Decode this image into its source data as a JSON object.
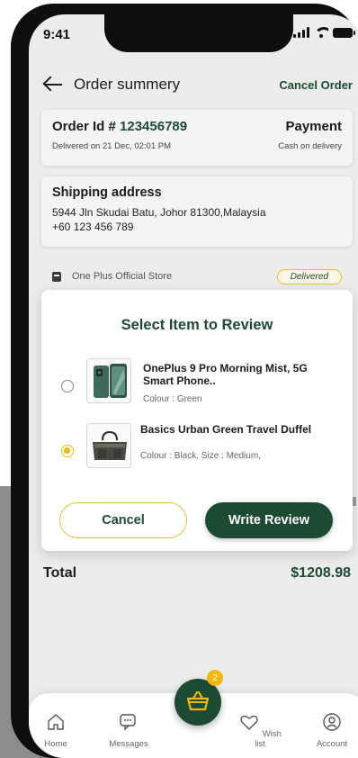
{
  "status_bar": {
    "time": "9:41"
  },
  "header": {
    "title": "Order summery",
    "cancel_label": "Cancel Order"
  },
  "order": {
    "id_label": "Order Id # ",
    "id": "123456789",
    "delivered_on": "Delivered on 21 Dec, 02:01 PM",
    "payment_label": "Payment",
    "payment_method": "Cash on delivery"
  },
  "shipping": {
    "title": "Shipping address",
    "address": "5944 Jln Skudai Batu, Johor 81300,Malaysia",
    "phone": "+60 123 456 789"
  },
  "store": {
    "name": "One Plus Official Store",
    "status": "Delivered"
  },
  "review_modal": {
    "title": "Select Item to Review",
    "items": [
      {
        "name": "OnePlus 9 Pro Morning Mist, 5G Smart Phone..",
        "variant": "Colour : Green",
        "selected": false,
        "thumb_icon": "phone-thumbnail"
      },
      {
        "name": "Basics Urban Green Travel Duffel",
        "variant": "Colour : Black, Size : Medium,",
        "selected": true,
        "thumb_icon": "duffel-bag-thumbnail"
      }
    ],
    "cancel_label": "Cancel",
    "write_review_label": "Write Review"
  },
  "total": {
    "label": "Total",
    "amount": "$1208.98"
  },
  "nav": {
    "home": "Home",
    "messages": "Messages",
    "wishlist": "Wish list",
    "account": "Account",
    "cart_count": "2"
  },
  "colors": {
    "primary": "#1d4a33",
    "accent": "#f0b90b",
    "background": "#ececec"
  }
}
